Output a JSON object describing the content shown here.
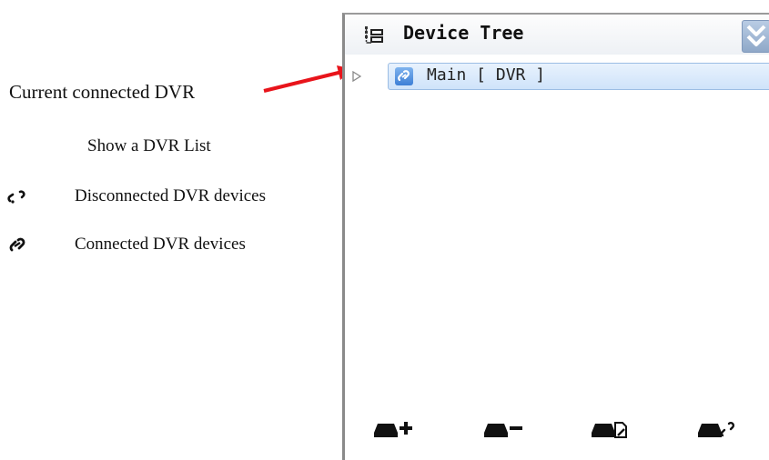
{
  "annotations": {
    "current_dvr": "Current connected DVR",
    "show_list": "Show a DVR List"
  },
  "legend": [
    {
      "icon": "disconnected-link-icon",
      "label": "Disconnected DVR devices"
    },
    {
      "icon": "connected-link-icon",
      "label": "Connected DVR devices"
    }
  ],
  "panel": {
    "title": "Device Tree",
    "header_icon": "device-tree-icon",
    "collapse_icon": "double-chevron-down-icon",
    "tree": [
      {
        "label": "Main [ DVR ]",
        "icon": "connected-link-icon",
        "expanded": false
      }
    ],
    "toolbar": [
      {
        "name": "add-device-button",
        "icon": "add-device-icon"
      },
      {
        "name": "remove-device-button",
        "icon": "remove-device-icon"
      },
      {
        "name": "edit-device-button",
        "icon": "edit-device-icon"
      },
      {
        "name": "connect-device-button",
        "icon": "connect-device-icon"
      }
    ]
  },
  "colors": {
    "arrow": "#e8141b",
    "selection_bg": "#d9e9fb",
    "selection_border": "#9cbde4",
    "collapse_button": "#9fb6d6"
  }
}
